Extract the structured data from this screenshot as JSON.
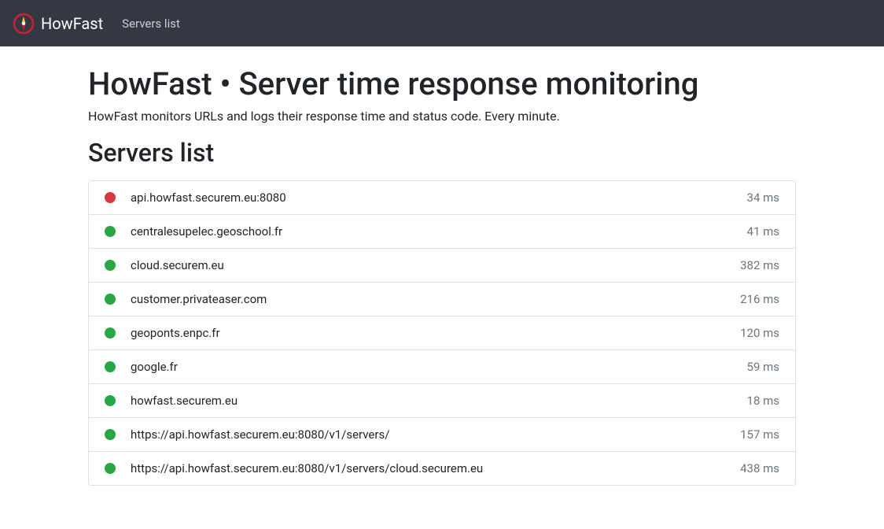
{
  "navbar": {
    "brand": "HowFast",
    "link_servers": "Servers list"
  },
  "page": {
    "title": "HowFast • Server time response monitoring",
    "subtitle": "HowFast monitors URLs and logs their response time and status code. Every minute.",
    "section_title": "Servers list"
  },
  "servers": [
    {
      "url": "api.howfast.securem.eu:8080",
      "time": "34 ms",
      "status": "down"
    },
    {
      "url": "centralesupelec.geoschool.fr",
      "time": "41 ms",
      "status": "up"
    },
    {
      "url": "cloud.securem.eu",
      "time": "382 ms",
      "status": "up"
    },
    {
      "url": "customer.privateaser.com",
      "time": "216 ms",
      "status": "up"
    },
    {
      "url": "geoponts.enpc.fr",
      "time": "120 ms",
      "status": "up"
    },
    {
      "url": "google.fr",
      "time": "59 ms",
      "status": "up"
    },
    {
      "url": "howfast.securem.eu",
      "time": "18 ms",
      "status": "up"
    },
    {
      "url": "https://api.howfast.securem.eu:8080/v1/servers/",
      "time": "157 ms",
      "status": "up"
    },
    {
      "url": "https://api.howfast.securem.eu:8080/v1/servers/cloud.securem.eu",
      "time": "438 ms",
      "status": "up"
    }
  ]
}
